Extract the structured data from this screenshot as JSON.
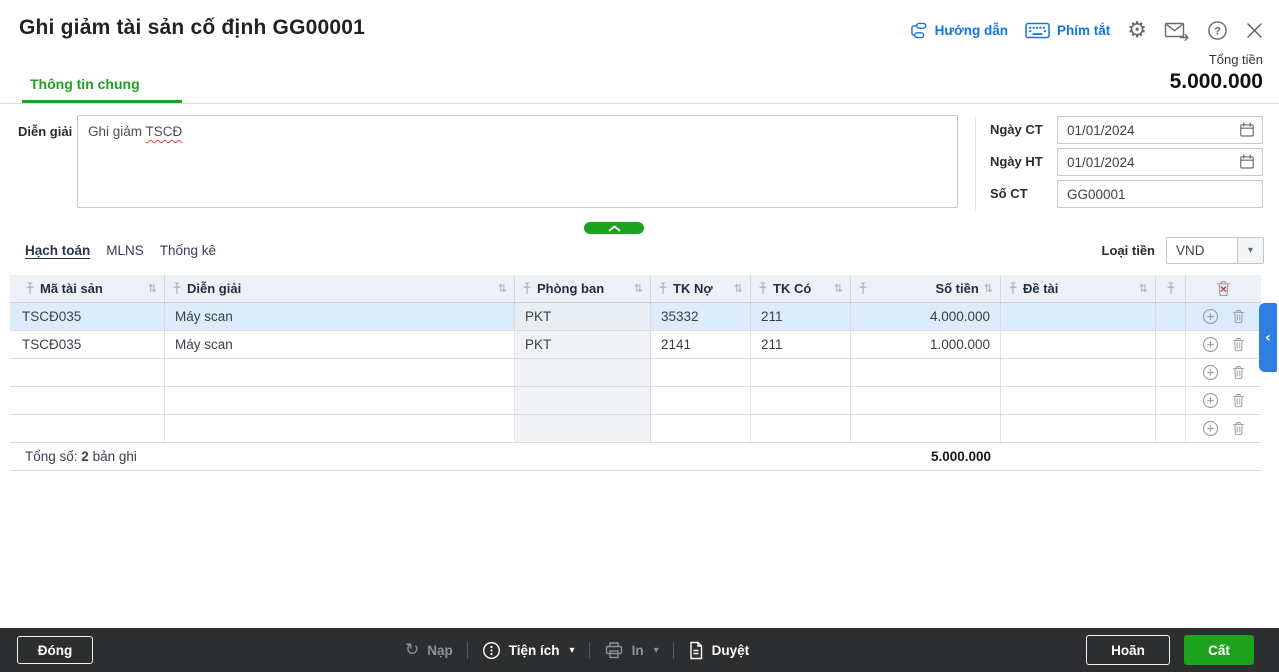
{
  "window": {
    "title": "Ghi giảm tài sản cố định GG00001"
  },
  "header": {
    "guide_link": "Hướng dẫn",
    "shortcuts_link": "Phím tắt",
    "total_caption": "Tổng tiền",
    "total_value": "5.000.000",
    "tab": "Thông tin chung"
  },
  "form": {
    "description_label": "Diễn giải",
    "description_value_prefix": "Ghi giảm ",
    "description_misspelled_word": "TSCĐ",
    "fields": [
      {
        "label": "Ngày CT",
        "value": "01/01/2024"
      },
      {
        "label": "Ngày HT",
        "value": "01/01/2024"
      },
      {
        "label": "Số CT",
        "value": "GG00001"
      }
    ]
  },
  "detail": {
    "tabs": [
      {
        "label": "Hạch toán",
        "active": true
      },
      {
        "label": "MLNS",
        "active": false
      },
      {
        "label": "Thống kê",
        "active": false
      }
    ],
    "currency_label": "Loại tiền",
    "currency_value": "VND"
  },
  "table": {
    "columns": [
      {
        "label": "Mã tài sản"
      },
      {
        "label": "Diễn giải"
      },
      {
        "label": "Phòng ban"
      },
      {
        "label": "TK Nợ"
      },
      {
        "label": "TK Có"
      },
      {
        "label": "Số tiền"
      },
      {
        "label": "Đề tài"
      }
    ],
    "rows": [
      {
        "asset_code": "TSCĐ035",
        "description": "Máy scan",
        "department": "PKT",
        "debit_account": "35332",
        "credit_account": "211",
        "amount": "4.000.000",
        "topic": ""
      },
      {
        "asset_code": "TSCĐ035",
        "description": "Máy scan",
        "department": "PKT",
        "debit_account": "2141",
        "credit_account": "211",
        "amount": "1.000.000",
        "topic": ""
      },
      {
        "asset_code": "",
        "description": "",
        "department": "",
        "debit_account": "",
        "credit_account": "",
        "amount": "",
        "topic": ""
      },
      {
        "asset_code": "",
        "description": "",
        "department": "",
        "debit_account": "",
        "credit_account": "",
        "amount": "",
        "topic": ""
      },
      {
        "asset_code": "",
        "description": "",
        "department": "",
        "debit_account": "",
        "credit_account": "",
        "amount": "",
        "topic": ""
      }
    ],
    "summary": {
      "prefix": "Tổng số:",
      "count": "2",
      "suffix": "bản ghi",
      "total_amount": "5.000.000"
    }
  },
  "action_bar": {
    "close": "Đóng",
    "reload": "Nạp",
    "utilities": "Tiện ích",
    "print": "In",
    "approve": "Duyệt",
    "postpone": "Hoãn",
    "save": "Cất"
  },
  "icons": {
    "gear": "⚙",
    "refresh": "↻",
    "sort": "⇅",
    "caret_down": "▾",
    "chevron_left": "‹"
  },
  "colors": {
    "accent_green": "#1da21d",
    "link_blue": "#1473e6",
    "selected_row": "#dcecfb",
    "side_tab_blue": "#2f7fe3",
    "bottom_bar": "#2c2e30",
    "table_header_bg": "#edf0f4",
    "department_column_bg": "#f0f2f5"
  }
}
